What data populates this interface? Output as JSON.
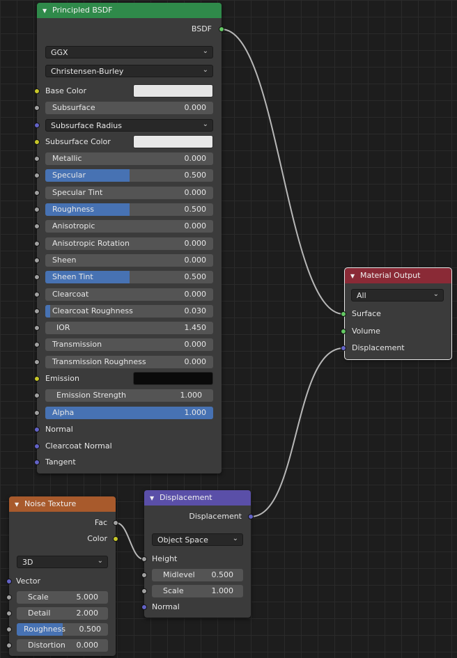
{
  "principled": {
    "title": "Principled BSDF",
    "output": "BSDF",
    "distribution": "GGX",
    "subsurface_method": "Christensen-Burley",
    "base_color": {
      "label": "Base Color",
      "color": "#e6e6e6"
    },
    "subsurface": {
      "label": "Subsurface",
      "value": "0.000"
    },
    "subsurface_radius": "Subsurface Radius",
    "subsurface_color": {
      "label": "Subsurface Color",
      "color": "#e8e8e8"
    },
    "metallic": {
      "label": "Metallic",
      "value": "0.000"
    },
    "specular": {
      "label": "Specular",
      "value": "0.500",
      "fraction": 0.5
    },
    "specular_tint": {
      "label": "Specular Tint",
      "value": "0.000"
    },
    "roughness": {
      "label": "Roughness",
      "value": "0.500",
      "fraction": 0.5
    },
    "anisotropic": {
      "label": "Anisotropic",
      "value": "0.000"
    },
    "anisotropic_rotation": {
      "label": "Anisotropic Rotation",
      "value": "0.000"
    },
    "sheen": {
      "label": "Sheen",
      "value": "0.000"
    },
    "sheen_tint": {
      "label": "Sheen Tint",
      "value": "0.500",
      "fraction": 0.5
    },
    "clearcoat": {
      "label": "Clearcoat",
      "value": "0.000"
    },
    "clearcoat_roughness": {
      "label": "Clearcoat Roughness",
      "value": "0.030",
      "fraction": 0.03
    },
    "ior": {
      "label": "IOR",
      "value": "1.450"
    },
    "transmission": {
      "label": "Transmission",
      "value": "0.000"
    },
    "transmission_roughness": {
      "label": "Transmission Roughness",
      "value": "0.000"
    },
    "emission": {
      "label": "Emission",
      "color": "#0a0a0a"
    },
    "emission_strength": {
      "label": "Emission Strength",
      "value": "1.000"
    },
    "alpha": {
      "label": "Alpha",
      "value": "1.000",
      "fraction": 1.0
    },
    "normal": "Normal",
    "clearcoat_normal": "Clearcoat Normal",
    "tangent": "Tangent"
  },
  "material_output": {
    "title": "Material Output",
    "target": "All",
    "surface": "Surface",
    "volume": "Volume",
    "displacement": "Displacement"
  },
  "noise": {
    "title": "Noise Texture",
    "fac": "Fac",
    "color": "Color",
    "dimensions": "3D",
    "vector": "Vector",
    "scale": {
      "label": "Scale",
      "value": "5.000"
    },
    "detail": {
      "label": "Detail",
      "value": "2.000"
    },
    "roughness": {
      "label": "Roughness",
      "value": "0.500",
      "fraction": 0.5
    },
    "distortion": {
      "label": "Distortion",
      "value": "0.000"
    }
  },
  "displacement": {
    "title": "Displacement",
    "output": "Displacement",
    "space": "Object Space",
    "height": "Height",
    "midlevel": {
      "label": "Midlevel",
      "value": "0.500"
    },
    "scale": {
      "label": "Scale",
      "value": "1.000"
    },
    "normal": "Normal"
  },
  "colors": {
    "header_shader": "#2f8a4a",
    "header_output": "#8a2a36",
    "header_texture": "#a85a2c",
    "header_vector": "#5a4fa8",
    "link": "#b8b8b8",
    "field_fill": "#4772b3"
  }
}
